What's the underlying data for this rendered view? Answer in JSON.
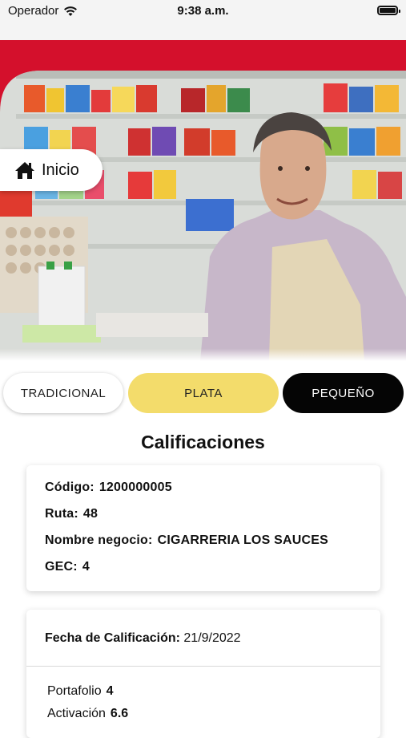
{
  "status_bar": {
    "carrier": "Operador",
    "time": "9:38 a.m."
  },
  "hero": {
    "inicio_label": "Inicio"
  },
  "segments": [
    {
      "label": "TRADICIONAL",
      "selected": false
    },
    {
      "label": "PLATA",
      "selected": true
    },
    {
      "label": "PEQUEÑO",
      "selected": false
    }
  ],
  "section_title": "Calificaciones",
  "info_card": {
    "codigo_label": "Código:",
    "codigo_value": "1200000005",
    "ruta_label": "Ruta:",
    "ruta_value": "48",
    "nombre_label": "Nombre negocio:",
    "nombre_value": "CIGARRERIA LOS SAUCES",
    "gec_label": "GEC:",
    "gec_value": "4"
  },
  "rating_card": {
    "fecha_label": "Fecha de Calificación:",
    "fecha_value": "21/9/2022",
    "metrics": [
      {
        "label": "Portafolio",
        "value": "4"
      },
      {
        "label": "Activación",
        "value": "6.6"
      }
    ]
  },
  "colors": {
    "brand_red": "#d4102c",
    "plata_yellow": "#f3dc6b",
    "peq_black": "#050505"
  }
}
